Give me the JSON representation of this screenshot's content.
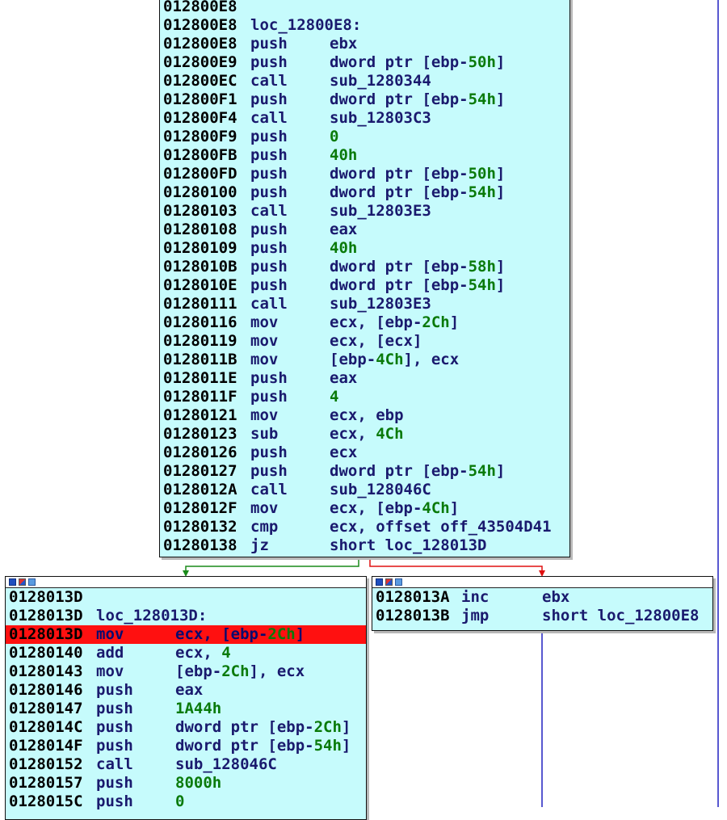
{
  "blocks": {
    "main": {
      "label_line": {
        "addr": "012800E8",
        "text": "loc_12800E8:"
      },
      "lines": [
        {
          "addr": "012800E8",
          "mn": "push",
          "op": "ebx"
        },
        {
          "addr": "012800E9",
          "mn": "push",
          "op": "dword ptr [ebp-",
          "num": "50h",
          "tail": "]"
        },
        {
          "addr": "012800EC",
          "mn": "call",
          "op": "sub_1280344"
        },
        {
          "addr": "012800F1",
          "mn": "push",
          "op": "dword ptr [ebp-",
          "num": "54h",
          "tail": "]"
        },
        {
          "addr": "012800F4",
          "mn": "call",
          "op": "sub_12803C3"
        },
        {
          "addr": "012800F9",
          "mn": "push",
          "op": "",
          "num": "0",
          "tail": ""
        },
        {
          "addr": "012800FB",
          "mn": "push",
          "op": "",
          "num": "40h",
          "tail": ""
        },
        {
          "addr": "012800FD",
          "mn": "push",
          "op": "dword ptr [ebp-",
          "num": "50h",
          "tail": "]"
        },
        {
          "addr": "01280100",
          "mn": "push",
          "op": "dword ptr [ebp-",
          "num": "54h",
          "tail": "]"
        },
        {
          "addr": "01280103",
          "mn": "call",
          "op": "sub_12803E3"
        },
        {
          "addr": "01280108",
          "mn": "push",
          "op": "eax"
        },
        {
          "addr": "01280109",
          "mn": "push",
          "op": "",
          "num": "40h",
          "tail": ""
        },
        {
          "addr": "0128010B",
          "mn": "push",
          "op": "dword ptr [ebp-",
          "num": "58h",
          "tail": "]"
        },
        {
          "addr": "0128010E",
          "mn": "push",
          "op": "dword ptr [ebp-",
          "num": "54h",
          "tail": "]"
        },
        {
          "addr": "01280111",
          "mn": "call",
          "op": "sub_12803E3"
        },
        {
          "addr": "01280116",
          "mn": "mov",
          "op": "ecx, [ebp-",
          "num": "2Ch",
          "tail": "]"
        },
        {
          "addr": "01280119",
          "mn": "mov",
          "op": "ecx, [ecx]"
        },
        {
          "addr": "0128011B",
          "mn": "mov",
          "op": "[ebp-",
          "num": "4Ch",
          "tail": "], ecx"
        },
        {
          "addr": "0128011E",
          "mn": "push",
          "op": "eax"
        },
        {
          "addr": "0128011F",
          "mn": "push",
          "op": "",
          "num": "4",
          "tail": ""
        },
        {
          "addr": "01280121",
          "mn": "mov",
          "op": "ecx, ebp"
        },
        {
          "addr": "01280123",
          "mn": "sub",
          "op": "ecx, ",
          "num": "4Ch",
          "tail": ""
        },
        {
          "addr": "01280126",
          "mn": "push",
          "op": "ecx"
        },
        {
          "addr": "01280127",
          "mn": "push",
          "op": "dword ptr [ebp-",
          "num": "54h",
          "tail": "]"
        },
        {
          "addr": "0128012A",
          "mn": "call",
          "op": "sub_128046C"
        },
        {
          "addr": "0128012F",
          "mn": "mov",
          "op": "ecx, [ebp-",
          "num": "4Ch",
          "tail": "]"
        },
        {
          "addr": "01280132",
          "mn": "cmp",
          "op": "ecx, offset off_43504D41"
        },
        {
          "addr": "01280138",
          "mn": "jz",
          "op": "short loc_128013D"
        }
      ]
    },
    "left": {
      "addr_line": {
        "addr": "0128013D"
      },
      "label_line": {
        "addr": "0128013D",
        "text": "loc_128013D:"
      },
      "lines": [
        {
          "addr": "0128013D",
          "mn": "mov",
          "op": "ecx, [ebp-",
          "num": "2Ch",
          "tail": "]",
          "highlight": true
        },
        {
          "addr": "01280140",
          "mn": "add",
          "op": "ecx, ",
          "num": "4",
          "tail": ""
        },
        {
          "addr": "01280143",
          "mn": "mov",
          "op": "[ebp-",
          "num": "2Ch",
          "tail": "], ecx"
        },
        {
          "addr": "01280146",
          "mn": "push",
          "op": "eax"
        },
        {
          "addr": "01280147",
          "mn": "push",
          "op": "",
          "num": "1A44h",
          "tail": ""
        },
        {
          "addr": "0128014C",
          "mn": "push",
          "op": "dword ptr [ebp-",
          "num": "2Ch",
          "tail": "]"
        },
        {
          "addr": "0128014F",
          "mn": "push",
          "op": "dword ptr [ebp-",
          "num": "54h",
          "tail": "]"
        },
        {
          "addr": "01280152",
          "mn": "call",
          "op": "sub_128046C"
        },
        {
          "addr": "01280157",
          "mn": "push",
          "op": "",
          "num": "8000h",
          "tail": ""
        },
        {
          "addr": "0128015C",
          "mn": "push",
          "op": "",
          "num": "0",
          "tail": ""
        }
      ]
    },
    "right": {
      "lines": [
        {
          "addr": "0128013A",
          "mn": "inc",
          "op": "ebx"
        },
        {
          "addr": "0128013B",
          "mn": "jmp",
          "op": "short loc_12800E8"
        }
      ]
    }
  },
  "top_partial_addr": "012800E8",
  "colors": {
    "block_bg": "#c6fbfc",
    "highlight": "#ff1010",
    "edge_true": "#1a8a1a",
    "edge_false": "#e01010",
    "edge_back": "#2020c0",
    "number": "#0a7a0a",
    "mnemonic": "#1a1a6e"
  }
}
